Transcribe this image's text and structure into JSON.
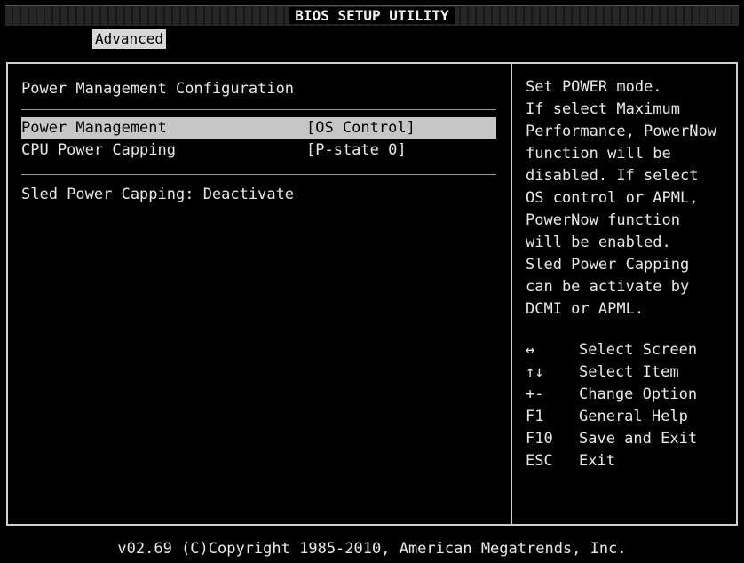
{
  "window": {
    "title": "BIOS SETUP UTILITY"
  },
  "tabs": [
    {
      "label": "Advanced",
      "selected": true
    }
  ],
  "main": {
    "section_title": "Power Management Configuration",
    "items": [
      {
        "label": "Power Management",
        "value": "[OS Control]",
        "selected": true
      },
      {
        "label": "CPU Power Capping",
        "value": "[P-state 0]",
        "selected": false
      }
    ],
    "status_line": "Sled Power Capping: Deactivate"
  },
  "help": {
    "text": "Set POWER mode.\nIf select Maximum\nPerformance, PowerNow\nfunction will be\ndisabled. If select\nOS control or APML,\nPowerNow function\nwill be enabled.\nSled Power Capping\ncan be activate by\nDCMI or APML.",
    "keys": [
      {
        "key": "↔",
        "desc": "Select Screen"
      },
      {
        "key": "↑↓",
        "desc": "Select Item"
      },
      {
        "key": "+-",
        "desc": "Change Option"
      },
      {
        "key": "F1",
        "desc": "General Help"
      },
      {
        "key": "F10",
        "desc": "Save and Exit"
      },
      {
        "key": "ESC",
        "desc": "Exit"
      }
    ]
  },
  "footer": {
    "text": "v02.69 (C)Copyright 1985-2010, American Megatrends, Inc."
  },
  "colors": {
    "background": "#000000",
    "text": "#e8e8e8",
    "highlight": "#c6c6c6",
    "border": "#cfcfcf"
  }
}
